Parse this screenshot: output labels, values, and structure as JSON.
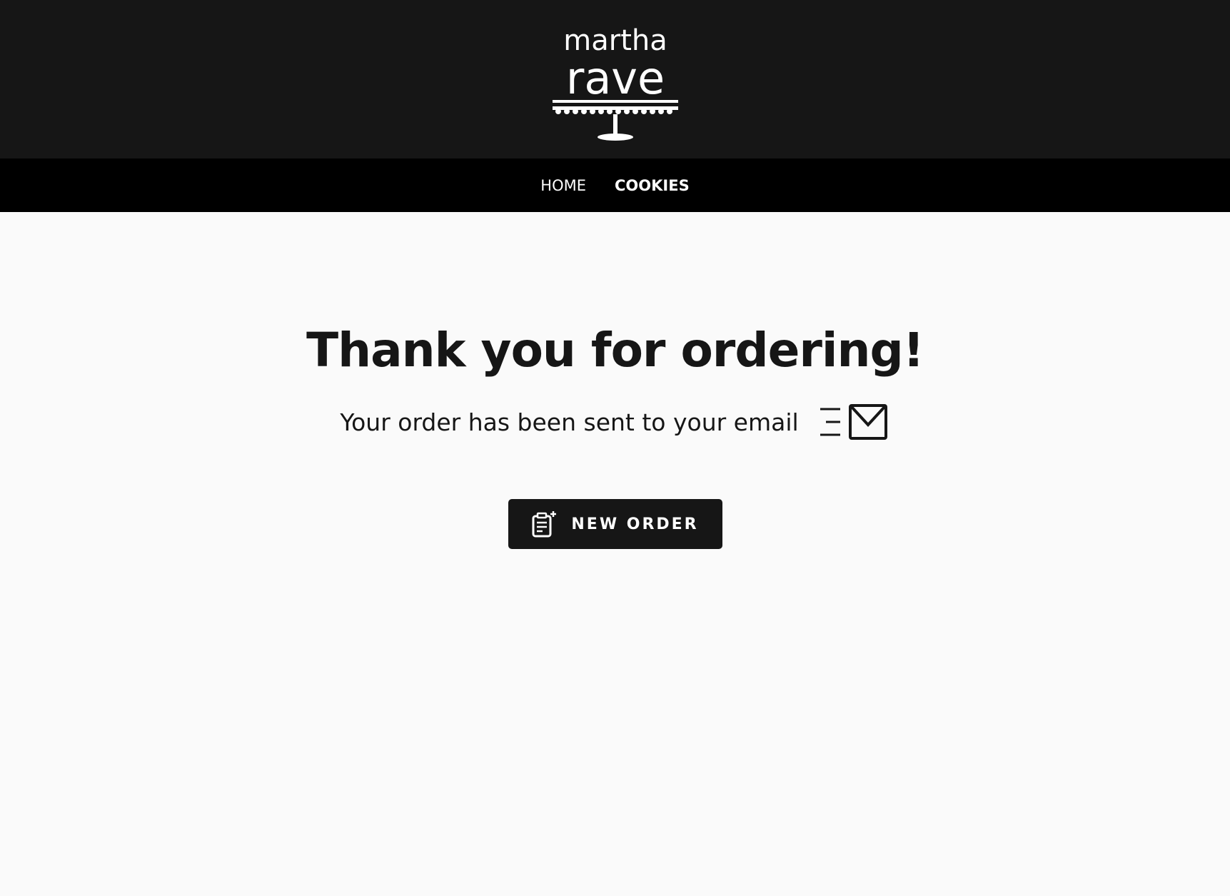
{
  "brand": {
    "logo_line1": "martha",
    "logo_line2": "rave",
    "logo_icon": "cake-stand-icon"
  },
  "nav": {
    "items": [
      {
        "label": "HOME",
        "active": false
      },
      {
        "label": "COOKIES",
        "active": true
      }
    ]
  },
  "main": {
    "title": "Thank you for ordering!",
    "subtitle": "Your order has been sent to your email",
    "subtitle_icon": "email-sent-icon",
    "new_order_button": {
      "label": "NEW ORDER",
      "icon": "new-order-clipboard-icon"
    }
  },
  "colors": {
    "header_bg": "#161616",
    "nav_bg": "#000000",
    "page_bg": "#fafafa",
    "text": "#161616",
    "button_bg": "#161616",
    "button_text": "#ffffff"
  }
}
